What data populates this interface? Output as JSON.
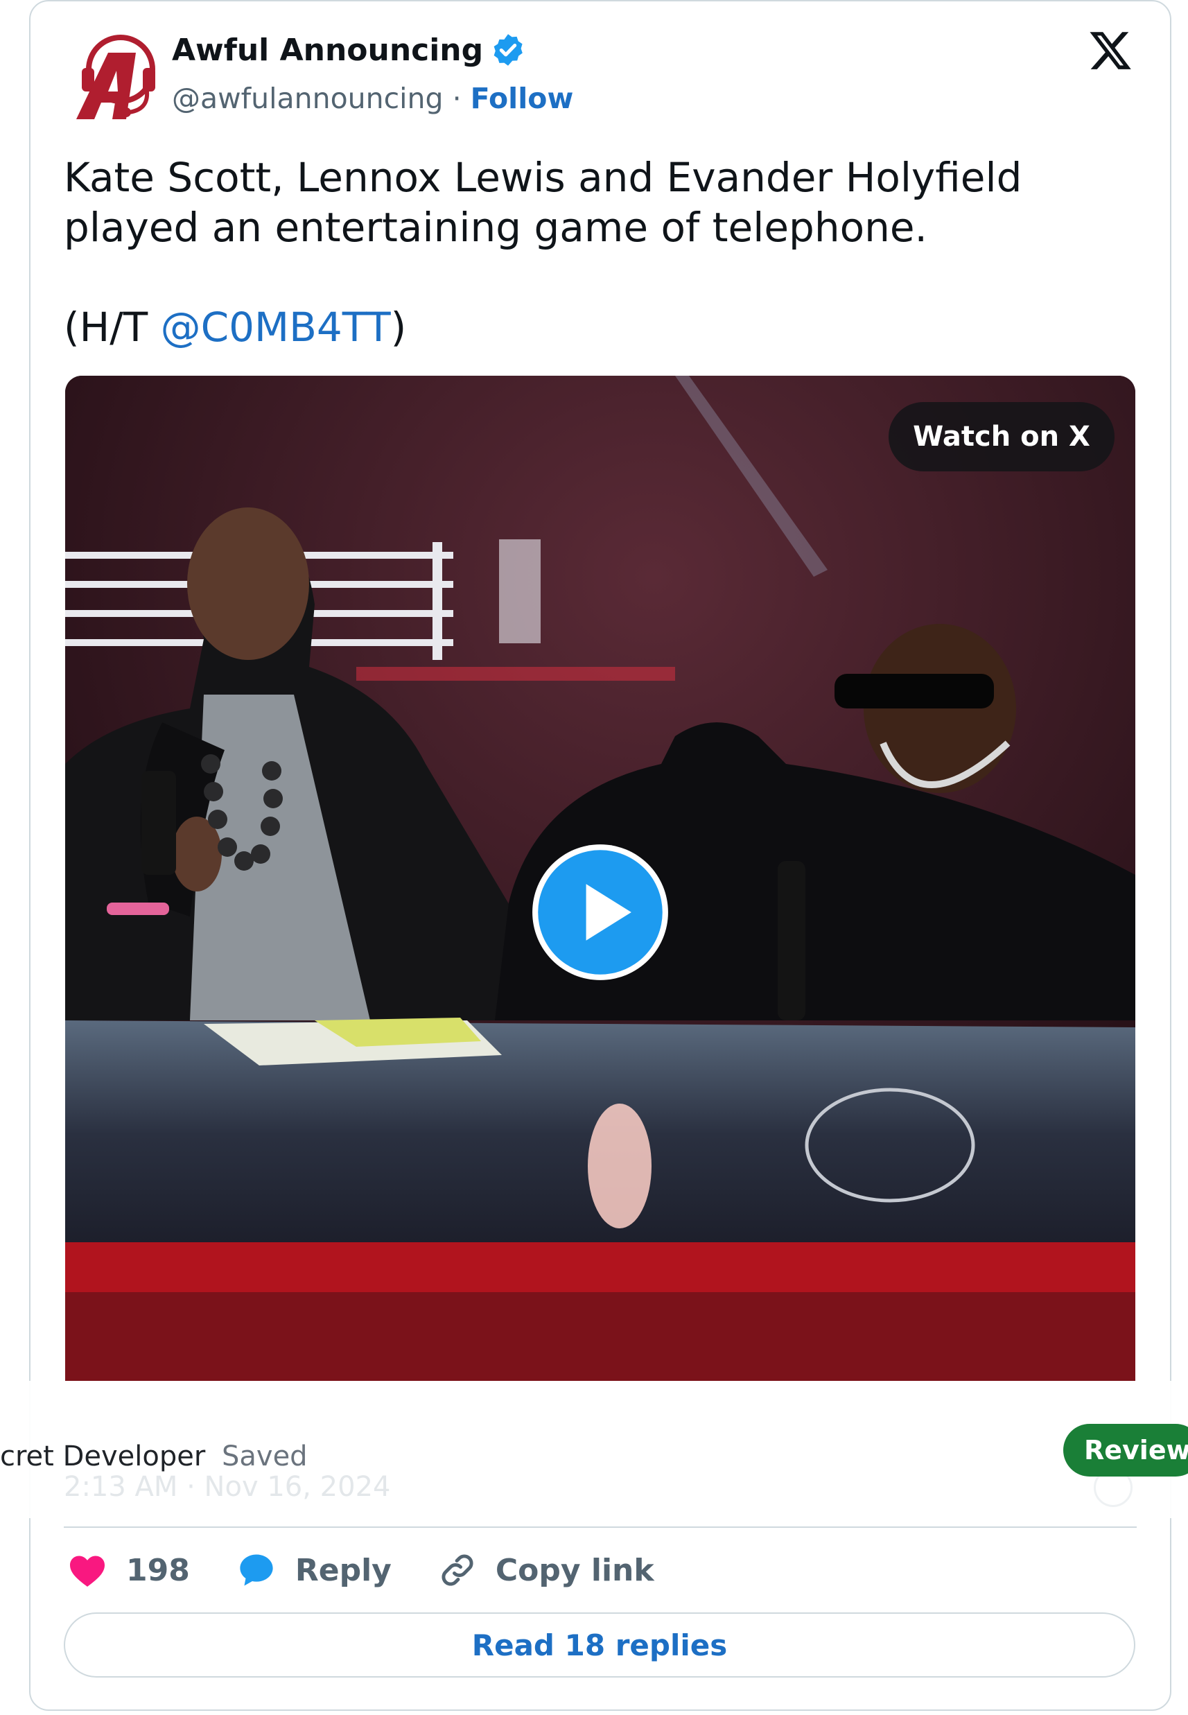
{
  "author": {
    "name": "Awful Announcing",
    "handle": "@awfulannouncing",
    "separator": " · ",
    "follow_label": "Follow"
  },
  "tweet": {
    "text": "Kate Scott, Lennox Lewis and Evander Holyfield played an entertaining game of telephone.\n\n(H/T ",
    "mention": "@C0MB4TT",
    "text_end": ")"
  },
  "media": {
    "watch_label": "Watch on X",
    "play_icon": "play-icon"
  },
  "overlay": {
    "author_fragment": "cret Developer",
    "status": "Saved",
    "review_label": "Review s"
  },
  "timestamp": "2:13 AM · Nov 16, 2024",
  "actions": {
    "likes": "198",
    "reply_label": "Reply",
    "copy_label": "Copy link"
  },
  "read_replies_label": "Read 18 replies",
  "colors": {
    "link": "#1d6fc4",
    "like": "#f91880",
    "reply": "#1d9bf0",
    "verified": "#1d9bf0",
    "review": "#1a7f37"
  }
}
